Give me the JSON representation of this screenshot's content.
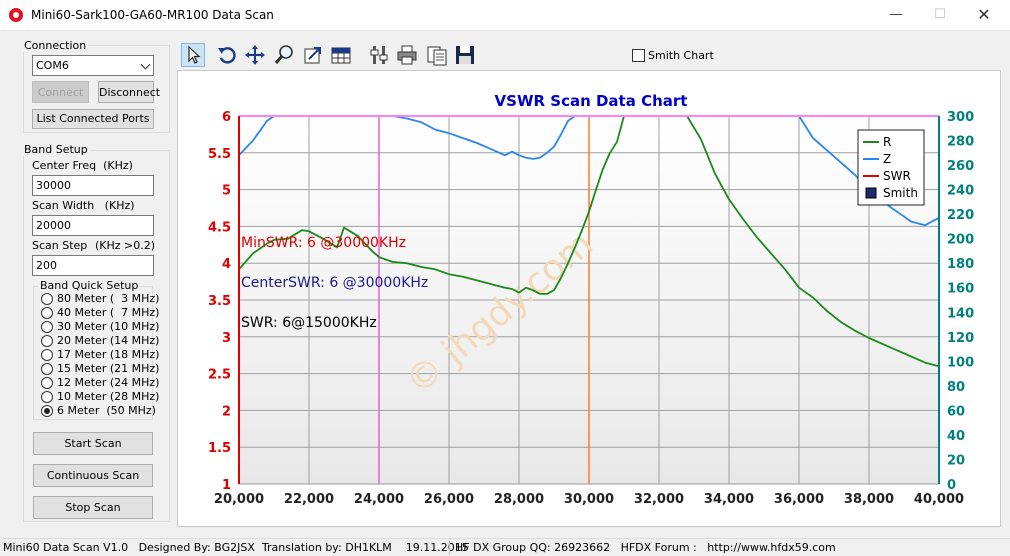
{
  "window": {
    "title": "Mini60-Sark100-GA60-MR100 Data Scan"
  },
  "connection": {
    "group_label": "Connection",
    "port": "COM6",
    "connect_label": "Connect",
    "disconnect_label": "Disconnect",
    "list_ports_label": "List Connected Ports"
  },
  "band_setup": {
    "group_label": "Band Setup",
    "center_label": "Center Freq  (KHz)",
    "center_value": "30000",
    "width_label": "Scan Width   (KHz)",
    "width_value": "20000",
    "step_label": "Scan Step",
    "step_hint": "(KHz >0.2)",
    "step_value": "200"
  },
  "quick_setup": {
    "group_label": "Band Quick Setup",
    "selected_index": 8,
    "bands": [
      "80 Meter (  3 MHz)",
      "40 Meter (  7 MHz)",
      "30 Meter (10 MHz)",
      "20 Meter (14 MHz)",
      "17 Meter (18 MHz)",
      "15 Meter (21 MHz)",
      "12 Meter (24 MHz)",
      "10 Meter (28 MHz)",
      "6 Meter  (50 MHz)"
    ]
  },
  "actions": {
    "start_label": "Start Scan",
    "continuous_label": "Continuous Scan",
    "stop_label": "Stop Scan"
  },
  "toolbar": {
    "smith_label": "Smith Chart",
    "smith_checked": false,
    "tools": [
      "pointer-icon",
      "rotate-icon",
      "move-icon",
      "zoom-icon",
      "export-icon",
      "table-icon",
      "settings-icon",
      "print-icon",
      "copy-icon",
      "save-icon"
    ]
  },
  "status": {
    "left": "Mini60 Data Scan V1.0   Designed By: BG2JSX  Translation by: DH1KLM    19.11.2015",
    "right": "HF DX Group QQ: 26923662   HFDX Forum :   http://www.hfdx59.com"
  },
  "watermark": "© jhgdy.com",
  "chart_data": {
    "type": "line",
    "title": "VSWR Scan Data Chart",
    "x": [
      20000,
      20400,
      20800,
      21000,
      21400,
      21800,
      22000,
      22400,
      22800,
      23000,
      23400,
      23800,
      24000,
      24400,
      24800,
      25200,
      25600,
      26000,
      26400,
      26800,
      27200,
      27600,
      27800,
      28000,
      28200,
      28400,
      28600,
      28800,
      29000,
      29200,
      29400,
      29600,
      29800,
      30000,
      30200,
      30400,
      30600,
      30800,
      31000,
      31200,
      31400,
      31600,
      31800,
      32000,
      32400,
      32800,
      33200,
      33600,
      34000,
      34400,
      34800,
      35200,
      35600,
      36000,
      36400,
      36800,
      37200,
      37600,
      38000,
      38400,
      38800,
      39200,
      39600,
      40000
    ],
    "series": [
      {
        "name": "R",
        "color": "#1a8a1a",
        "values": [
          175,
          188,
          196,
          199,
          200,
          207,
          206,
          200,
          193,
          209,
          202,
          190,
          185,
          181,
          180,
          177,
          175,
          171,
          169,
          166,
          163,
          160,
          159,
          156,
          160,
          158,
          155,
          155,
          158,
          168,
          180,
          193,
          207,
          222,
          240,
          257,
          270,
          279,
          300,
          300,
          300,
          300,
          300,
          300,
          300,
          300,
          281,
          253,
          232,
          216,
          201,
          188,
          175,
          160,
          152,
          141,
          132,
          125,
          119,
          114,
          109,
          104,
          99,
          96
        ]
      },
      {
        "name": "Z",
        "color": "#2a86f0",
        "values": [
          268,
          280,
          296,
          300,
          300,
          300,
          300,
          300,
          300,
          300,
          300,
          300,
          300,
          300,
          298,
          295,
          289,
          286,
          282,
          278,
          273,
          268,
          271,
          268,
          266,
          265,
          266,
          270,
          275,
          285,
          296,
          300,
          300,
          300,
          300,
          300,
          300,
          300,
          300,
          300,
          300,
          300,
          300,
          300,
          300,
          300,
          300,
          300,
          300,
          300,
          300,
          300,
          300,
          300,
          282,
          272,
          262,
          252,
          240,
          230,
          222,
          214,
          211,
          217
        ]
      },
      {
        "name": "SWR",
        "color": "#e00000",
        "values": []
      },
      {
        "name": "Smith",
        "color": "#1c2a6e",
        "values": []
      }
    ],
    "xlim": [
      20000,
      40000
    ],
    "xticks": [
      "20,000",
      "22,000",
      "24,000",
      "26,000",
      "28,000",
      "30,000",
      "32,000",
      "34,000",
      "36,000",
      "38,000",
      "40,000"
    ],
    "y_left": {
      "lim": [
        1,
        6
      ],
      "ticks": [
        "6",
        "5.5",
        "5",
        "4.5",
        "4",
        "3.5",
        "3",
        "2.5",
        "2",
        "1.5",
        "1"
      ]
    },
    "y_right": {
      "lim": [
        0,
        300
      ],
      "ticks": [
        "300",
        "280",
        "260",
        "240",
        "220",
        "200",
        "180",
        "160",
        "140",
        "120",
        "100",
        "80",
        "60",
        "40",
        "20",
        "0"
      ]
    },
    "markers": [
      {
        "x": 20000,
        "color": "#e00000"
      },
      {
        "x": 24000,
        "color": "#e060e0"
      },
      {
        "x": 30000,
        "color": "#ff7a30"
      }
    ],
    "annotations": {
      "min_swr": "MinSWR: 6 @30000KHz",
      "center_swr": "CenterSWR: 6 @30000KHz",
      "swr": "SWR: 6@15000KHz"
    },
    "legend_position": "top-right",
    "grid": true
  }
}
